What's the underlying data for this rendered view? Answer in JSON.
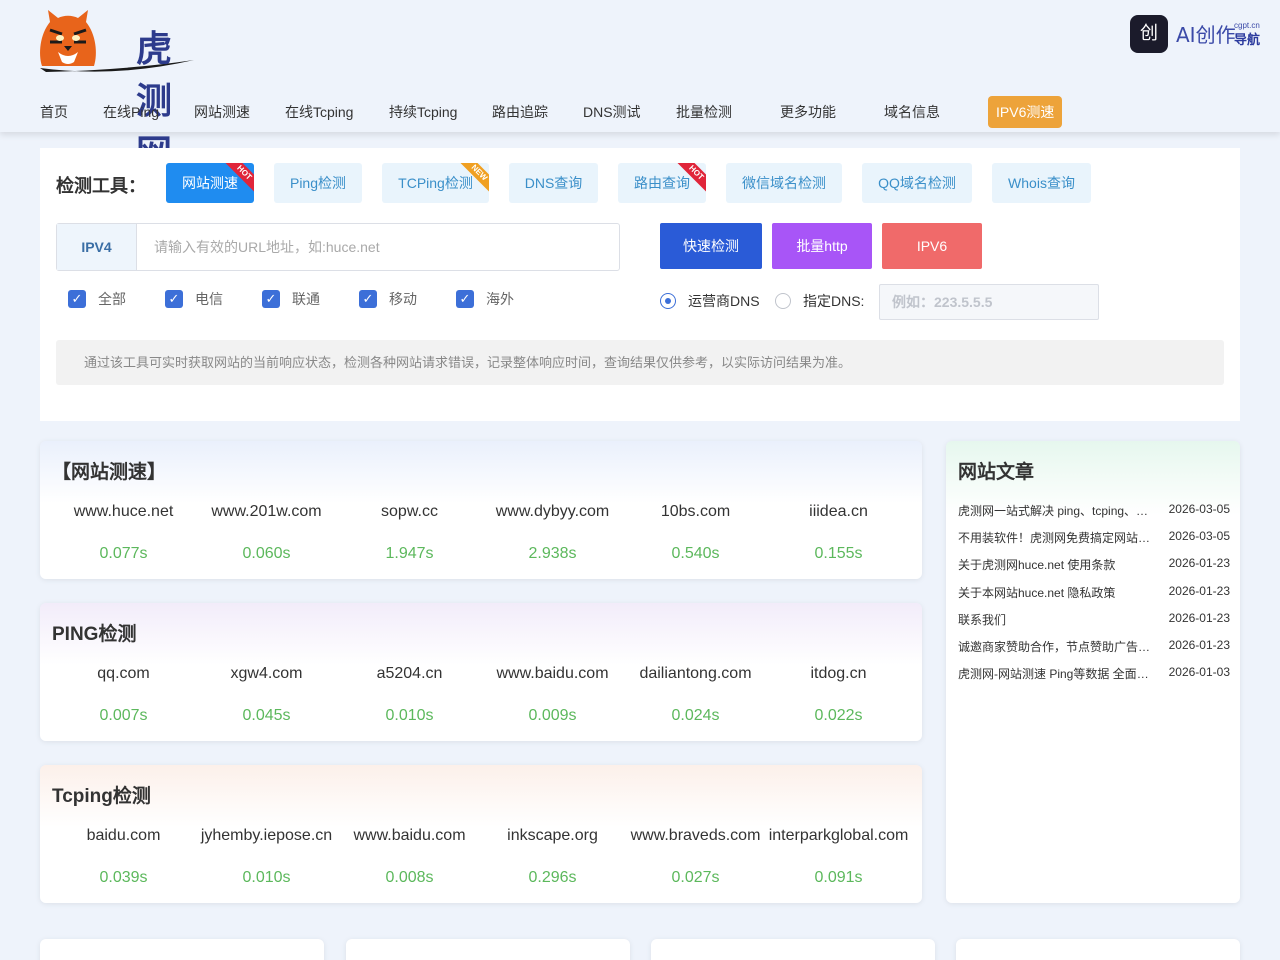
{
  "header": {
    "logo_text": "虎测网",
    "ai_nav": {
      "icon_text": "创",
      "label": "AI创作",
      "sub_small": "cgpt.cn",
      "sub_big": "导航"
    }
  },
  "nav": {
    "items": [
      {
        "label": "首页"
      },
      {
        "label": "在线Ping"
      },
      {
        "label": "网站测速"
      },
      {
        "label": "在线Tcping"
      },
      {
        "label": "持续Tcping"
      },
      {
        "label": "路由追踪"
      },
      {
        "label": "DNS测试"
      },
      {
        "label": "批量检测"
      },
      {
        "label": "更多功能"
      },
      {
        "label": "域名信息"
      },
      {
        "label": "IPV6测速",
        "active": true
      }
    ]
  },
  "tool": {
    "label": "检测工具：",
    "tabs": [
      {
        "label": "网站测速",
        "active": true,
        "badge": "HOT"
      },
      {
        "label": "Ping检测"
      },
      {
        "label": "TCPing检测",
        "badge": "NEW"
      },
      {
        "label": "DNS查询"
      },
      {
        "label": "路由查询",
        "badge": "HOT"
      },
      {
        "label": "微信域名检测"
      },
      {
        "label": "QQ域名检测"
      },
      {
        "label": "Whois查询"
      }
    ],
    "url_prefix": "IPV4",
    "url_placeholder": "请输入有效的URL地址，如:huce.net",
    "buttons": {
      "quick": "快速检测",
      "batch": "批量http",
      "ipv6": "IPV6"
    },
    "checkboxes": [
      {
        "label": "全部",
        "checked": true
      },
      {
        "label": "电信",
        "checked": true
      },
      {
        "label": "联通",
        "checked": true
      },
      {
        "label": "移动",
        "checked": true
      },
      {
        "label": "海外",
        "checked": true
      }
    ],
    "radios": [
      {
        "label": "运营商DNS",
        "checked": true
      },
      {
        "label": "指定DNS:",
        "checked": false
      }
    ],
    "dns_placeholder": "例如：223.5.5.5",
    "tip": "通过该工具可实时获取网站的当前响应状态，检测各种网站请求错误，记录整体响应时间，查询结果仅供参考，以实际访问结果为准。"
  },
  "cards": {
    "speed": {
      "title": "【网站测速】",
      "items": [
        {
          "site": "www.huce.net",
          "time": "0.077s"
        },
        {
          "site": "www.201w.com",
          "time": "0.060s"
        },
        {
          "site": "sopw.cc",
          "time": "1.947s"
        },
        {
          "site": "www.dybyy.com",
          "time": "2.938s"
        },
        {
          "site": "10bs.com",
          "time": "0.540s"
        },
        {
          "site": "iiidea.cn",
          "time": "0.155s"
        }
      ]
    },
    "ping": {
      "title": "PING检测",
      "items": [
        {
          "site": "qq.com",
          "time": "0.007s"
        },
        {
          "site": "xgw4.com",
          "time": "0.045s"
        },
        {
          "site": "a5204.cn",
          "time": "0.010s"
        },
        {
          "site": "www.baidu.com",
          "time": "0.009s"
        },
        {
          "site": "dailiantong.com",
          "time": "0.024s"
        },
        {
          "site": "itdog.cn",
          "time": "0.022s"
        }
      ]
    },
    "tcping": {
      "title": "Tcping检测",
      "items": [
        {
          "site": "baidu.com",
          "time": "0.039s"
        },
        {
          "site": "jyhemby.iepose.cn",
          "time": "0.010s"
        },
        {
          "site": "www.baidu.com",
          "time": "0.008s"
        },
        {
          "site": "inkscape.org",
          "time": "0.296s"
        },
        {
          "site": "www.braveds.com",
          "time": "0.027s"
        },
        {
          "site": "interparkglobal.com",
          "time": "0.091s"
        }
      ]
    }
  },
  "articles": {
    "title": "网站文章",
    "items": [
      {
        "title": "虎测网一站式解决 ping、tcping、http 检测问题",
        "date": "2026-03-05"
      },
      {
        "title": "不用装软件！虎测网免费搞定网站测速",
        "date": "2026-03-05"
      },
      {
        "title": "关于虎测网huce.net 使用条款",
        "date": "2026-01-23"
      },
      {
        "title": "关于本网站huce.net 隐私政策",
        "date": "2026-01-23"
      },
      {
        "title": "联系我们",
        "date": "2026-01-23"
      },
      {
        "title": "诚邀商家赞助合作，节点赞助广告合作",
        "date": "2026-01-23"
      },
      {
        "title": "虎测网-网站测速 Ping等数据 全面升级",
        "date": "2026-01-03"
      }
    ]
  },
  "colors": {
    "accent": "#1f8cf0",
    "quick_button": "#2a5bd7",
    "batch_button": "#a855f7",
    "ipv6_button": "#f06a6a",
    "nav_active": "#eda33a",
    "time_green": "#5cb85c",
    "hot_ribbon": "#e0253a",
    "new_ribbon": "#f0a022"
  }
}
